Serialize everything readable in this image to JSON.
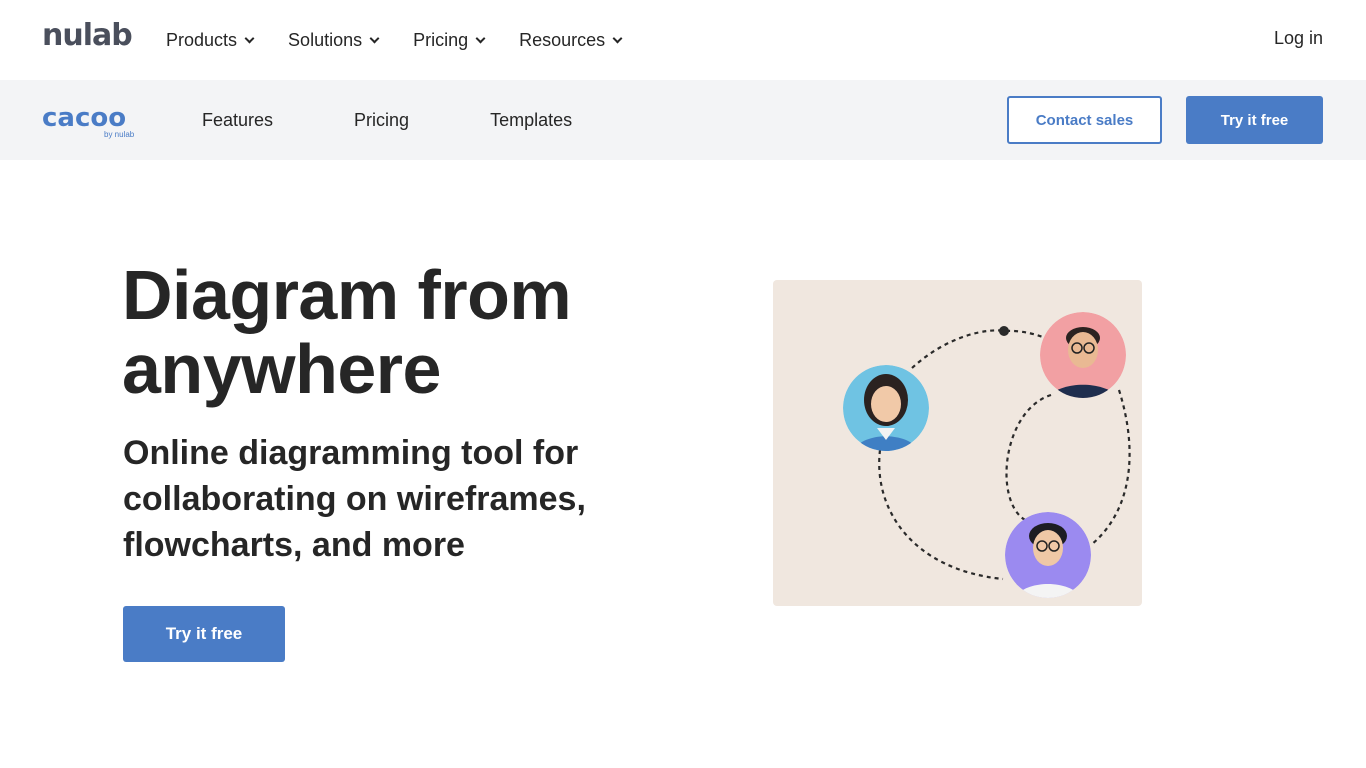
{
  "topbar": {
    "logo": "nulab",
    "nav": [
      {
        "label": "Products"
      },
      {
        "label": "Solutions"
      },
      {
        "label": "Pricing"
      },
      {
        "label": "Resources"
      }
    ],
    "login": "Log in"
  },
  "subbar": {
    "logo": "cacoo",
    "logo_by": "by nulab",
    "nav": [
      {
        "label": "Features"
      },
      {
        "label": "Pricing"
      },
      {
        "label": "Templates"
      }
    ],
    "contact_sales": "Contact sales",
    "try_free": "Try it free"
  },
  "hero": {
    "title_line1": "Diagram from",
    "title_line2": "anywhere",
    "subtitle_line1": "Online diagramming tool for",
    "subtitle_line2": "collaborating on wireframes,",
    "subtitle_line3": "flowcharts, and more",
    "cta": "Try it free"
  },
  "colors": {
    "accent": "#4a7cc6",
    "subbar_bg": "#f3f4f6",
    "illustration_bg": "#f0e7df",
    "avatar_left_bg": "#6fc3e3",
    "avatar_top_bg": "#f2a0a3",
    "avatar_bottom_bg": "#9b8af0"
  },
  "illustration": {
    "avatars": [
      "avatar-woman-icon",
      "avatar-man-glasses-icon",
      "avatar-person-glasses-icon"
    ]
  }
}
